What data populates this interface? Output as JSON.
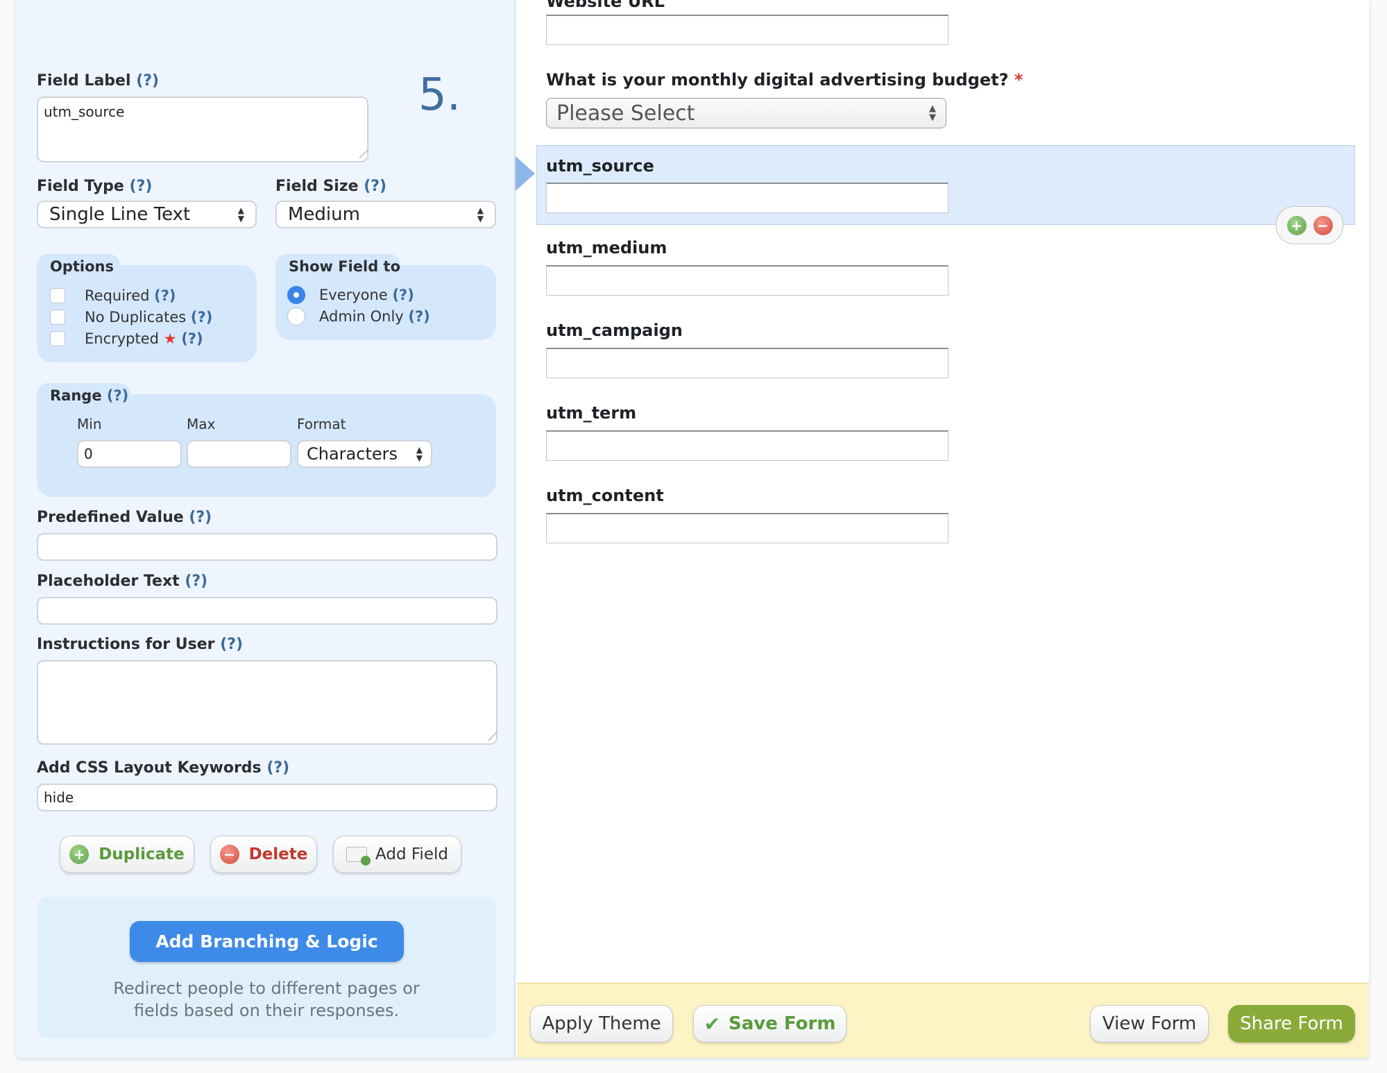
{
  "editor": {
    "field_number": "5.",
    "help_mark": "(?)",
    "field_label": {
      "label": "Field Label",
      "value": "utm_source"
    },
    "field_type": {
      "label": "Field Type",
      "selected": "Single Line Text"
    },
    "field_size": {
      "label": "Field Size",
      "selected": "Medium"
    },
    "options": {
      "title": "Options",
      "items": [
        {
          "label": "Required",
          "checked": false
        },
        {
          "label": "No Duplicates",
          "checked": false
        },
        {
          "label": "Encrypted",
          "checked": false,
          "badge": "★"
        }
      ]
    },
    "show_field_to": {
      "title": "Show Field to",
      "items": [
        {
          "label": "Everyone",
          "selected": true
        },
        {
          "label": "Admin Only",
          "selected": false
        }
      ]
    },
    "range": {
      "title": "Range",
      "min_label": "Min",
      "min_value": "0",
      "max_label": "Max",
      "max_value": "",
      "format_label": "Format",
      "format_selected": "Characters"
    },
    "predefined_value": {
      "label": "Predefined Value",
      "value": ""
    },
    "placeholder_text": {
      "label": "Placeholder Text",
      "value": ""
    },
    "instructions": {
      "label": "Instructions for User",
      "value": ""
    },
    "css_keywords": {
      "label": "Add CSS Layout Keywords",
      "value": "hide"
    },
    "buttons": {
      "duplicate": "Duplicate",
      "delete": "Delete",
      "add_field": "Add Field"
    },
    "branching": {
      "button": "Add Branching & Logic",
      "description_line1": "Redirect people to different pages or",
      "description_line2": "fields based on their responses."
    }
  },
  "preview": {
    "partial_label": "Website URL",
    "budget_question": "What is your monthly digital advertising budget?",
    "required_mark": "*",
    "budget_select": "Please Select",
    "fields": [
      {
        "label": "utm_source",
        "selected": true
      },
      {
        "label": "utm_medium"
      },
      {
        "label": "utm_campaign"
      },
      {
        "label": "utm_term"
      },
      {
        "label": "utm_content"
      }
    ]
  },
  "footer": {
    "apply_theme": "Apply Theme",
    "save_form": "Save Form",
    "view_form": "View Form",
    "share_form": "Share Form"
  },
  "colors": {
    "accent_blue": "#3a86e8",
    "share_green": "#8aab3a",
    "save_green": "#5a9a3c",
    "delete_red": "#c0392b",
    "footer_yellow": "#fdf3c4",
    "selected_field_bg": "#ddebfc"
  }
}
